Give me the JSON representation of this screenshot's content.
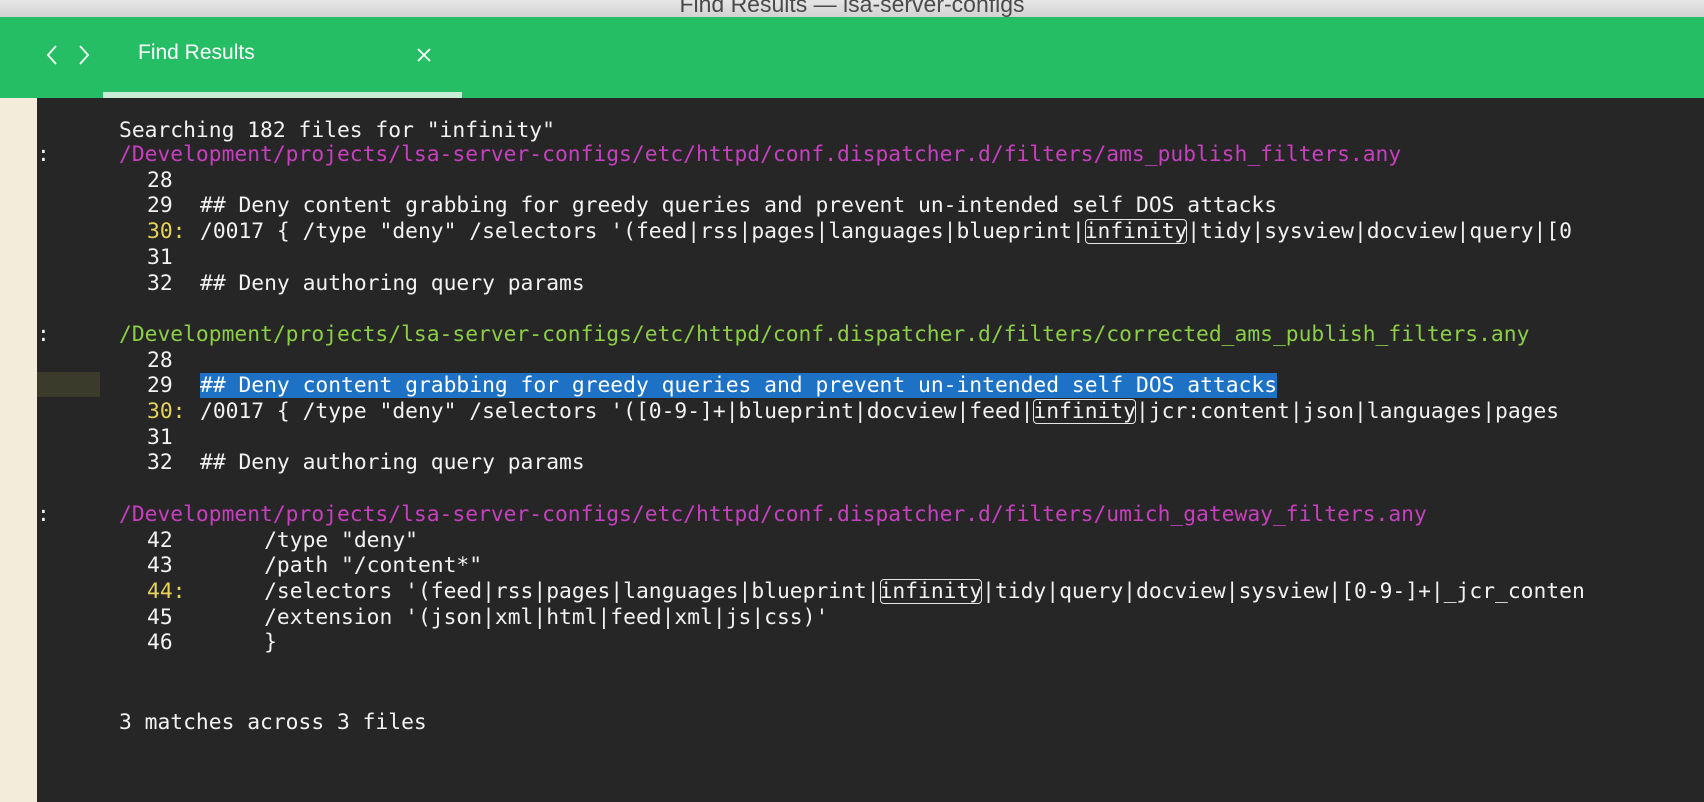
{
  "window": {
    "title": "Find Results — lsa-server-configs"
  },
  "tabs": [
    {
      "label": "Find Results",
      "close_icon": "close-icon"
    }
  ],
  "search": {
    "summary": "Searching 182 files for \"infinity\"",
    "footer": "3 matches across 3 files",
    "term": "infinity"
  },
  "results": [
    {
      "path": "/Development/projects/lsa-server-configs/etc/httpd/conf.dispatcher.d/filters/ams_publish_filters.any",
      "path_color": "#c83fc0",
      "lines": [
        {
          "num": "28",
          "text": "",
          "match": false
        },
        {
          "num": "29",
          "text": "## Deny content grabbing for greedy queries and prevent un-intended self DOS attacks",
          "match": false
        },
        {
          "num": "30:",
          "pre": "/0017 { /type \"deny\" /selectors '(feed|rss|pages|languages|blueprint|",
          "hit": "infinity",
          "post": "|tidy|sysview|docview|query|[0",
          "match": true
        },
        {
          "num": "31",
          "text": "",
          "match": false
        },
        {
          "num": "32",
          "text": "## Deny authoring query params",
          "match": false
        }
      ]
    },
    {
      "path": "/Development/projects/lsa-server-configs/etc/httpd/conf.dispatcher.d/filters/corrected_ams_publish_filters.any",
      "path_color": "#8ccf45",
      "lines": [
        {
          "num": "28",
          "text": "",
          "match": false
        },
        {
          "num": "29",
          "text": "## Deny content grabbing for greedy queries and prevent un-intended self DOS attacks",
          "match": false,
          "selected": true
        },
        {
          "num": "30:",
          "pre": "/0017 { /type \"deny\" /selectors '([0-9-]+|blueprint|docview|feed|",
          "hit": "infinity",
          "post": "|jcr:content|json|languages|pages",
          "match": true
        },
        {
          "num": "31",
          "text": "",
          "match": false
        },
        {
          "num": "32",
          "text": "## Deny authoring query params",
          "match": false
        }
      ]
    },
    {
      "path": "/Development/projects/lsa-server-configs/etc/httpd/conf.dispatcher.d/filters/umich_gateway_filters.any",
      "path_color": "#c83fc0",
      "lines": [
        {
          "num": "42",
          "text": "     /type \"deny\"",
          "match": false
        },
        {
          "num": "43",
          "text": "     /path \"/content*\"",
          "match": false
        },
        {
          "num": "44:",
          "pre": "     /selectors '(feed|rss|pages|languages|blueprint|",
          "hit": "infinity",
          "post": "|tidy|query|docview|sysview|[0-9-]+|_jcr_conten",
          "match": true
        },
        {
          "num": "45",
          "text": "     /extension '(json|xml|html|feed|xml|js|css)'",
          "match": false
        },
        {
          "num": "46",
          "text": "     }",
          "match": false
        }
      ]
    }
  ]
}
